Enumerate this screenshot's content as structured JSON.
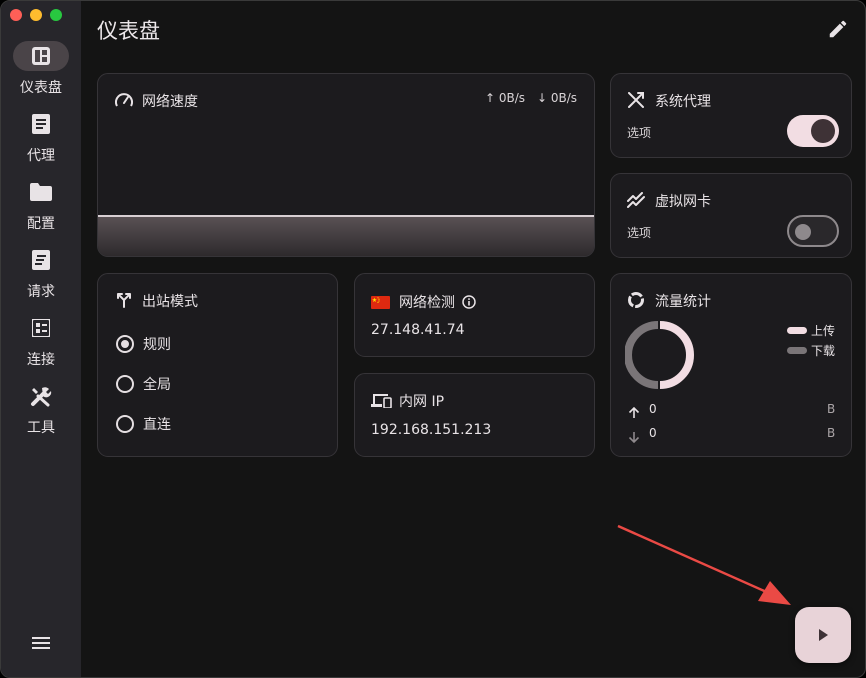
{
  "sidebar": {
    "items": [
      {
        "label": "仪表盘",
        "icon": "dashboard-icon"
      },
      {
        "label": "代理",
        "icon": "article-icon"
      },
      {
        "label": "配置",
        "icon": "folder-icon"
      },
      {
        "label": "请求",
        "icon": "request-log-icon"
      },
      {
        "label": "连接",
        "icon": "connections-icon"
      },
      {
        "label": "工具",
        "icon": "tools-icon"
      }
    ],
    "menu_icon": "menu-icon"
  },
  "header": {
    "title": "仪表盘",
    "edit_icon": "pencil-icon"
  },
  "speed": {
    "title": "网络速度",
    "up": "↑ 0B/s",
    "down": "↓ 0B/s"
  },
  "system_proxy": {
    "title": "系统代理",
    "sub": "选项",
    "enabled": true
  },
  "tun": {
    "title": "虚拟网卡",
    "sub": "选项",
    "enabled": false
  },
  "outbound": {
    "title": "出站模式",
    "options": [
      "规则",
      "全局",
      "直连"
    ],
    "selected": "规则"
  },
  "network_check": {
    "title": "网络检测",
    "ip": "27.148.41.74",
    "flag": "china-flag-icon"
  },
  "intranet": {
    "title": "内网 IP",
    "ip": "192.168.151.213"
  },
  "traffic": {
    "title": "流量统计",
    "legend": [
      {
        "label": "上传",
        "color": "#f2dde3"
      },
      {
        "label": "下载",
        "color": "#7a7578"
      }
    ],
    "up_value": "0",
    "up_unit": "B",
    "down_value": "0",
    "down_unit": "B"
  },
  "colors": {
    "accent": "#f2dde3",
    "background": "#141414",
    "card": "#1c1b1e",
    "sidebar": "#27262b",
    "annotation": "#ea4a45"
  }
}
